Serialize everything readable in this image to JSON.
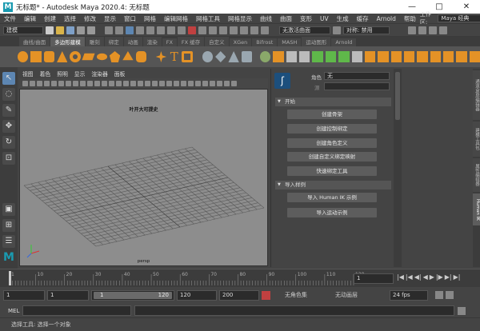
{
  "titlebar": {
    "title": "无标题* - Autodesk Maya 2020.4: 无标题",
    "minimize": "—",
    "maximize": "□",
    "close": "✕"
  },
  "menubar": {
    "items": [
      "文件",
      "编辑",
      "创建",
      "选择",
      "修改",
      "显示",
      "窗口",
      "网格",
      "编辑网格",
      "网格工具",
      "网格显示",
      "曲线",
      "曲面",
      "变形",
      "UV",
      "生成",
      "缓存",
      "Arnold",
      "帮助"
    ],
    "workspace_label": "工作区:",
    "workspace_value": "Maya 经典"
  },
  "statusline": {
    "mode": "建模",
    "no_live": "无激活曲面",
    "symmetry": "对称: 禁用"
  },
  "shelf_tabs": [
    "曲线/曲面",
    "多边形建模",
    "雕刻",
    "绑定",
    "动画",
    "渲染",
    "FX",
    "FX 缓存",
    "自定义",
    "XGen",
    "Bifrost",
    "MASH",
    "运动图形",
    "Arnold"
  ],
  "viewport": {
    "menu": [
      "视图",
      "着色",
      "照明",
      "显示",
      "渲染器",
      "面板"
    ],
    "title": "叶开大可提史",
    "camera": "persp"
  },
  "panel": {
    "char_label": "角色",
    "char_value": "无",
    "src_label": "源",
    "section_start": "开始",
    "btn_create_skeleton": "创建骨架",
    "btn_create_control": "创建控制绑定",
    "btn_create_char_def": "创建角色定义",
    "btn_create_custom": "创建自定义绑定映射",
    "btn_quick_rig": "快速绑定工具",
    "section_import": "导入样例",
    "btn_import_hik": "导入 Human IK 示例",
    "btn_import_mocap": "导入运动示例"
  },
  "side_tabs": [
    "通道盒/层编辑器",
    "建模工具包",
    "属性编辑器",
    "Human IK"
  ],
  "timeline": {
    "ticks": [
      "1",
      "10",
      "20",
      "30",
      "40",
      "50",
      "60",
      "70",
      "80",
      "90",
      "100",
      "110",
      "120"
    ],
    "current": "1"
  },
  "range": {
    "start": "1",
    "inner_start": "1",
    "slider_start": "1",
    "slider_end": "120",
    "inner_end": "120",
    "end": "200",
    "char_set": "无角色集",
    "anim_layer": "无动画层",
    "fps": "24 fps"
  },
  "mel": {
    "label": "MEL"
  },
  "help": {
    "text": "选择工具: 选择一个对象"
  },
  "colors": {
    "accent": "#5d86b2",
    "shelf_orange": "#e49226"
  }
}
